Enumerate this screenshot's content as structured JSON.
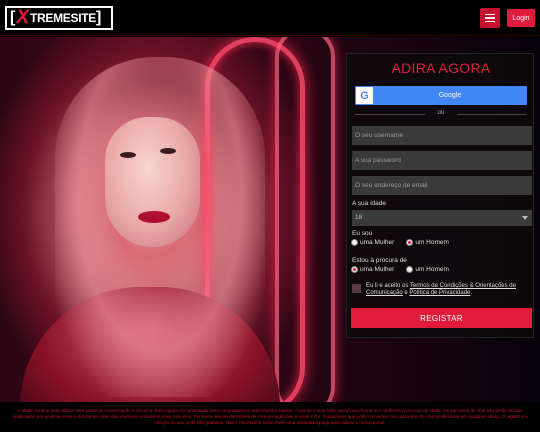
{
  "header": {
    "logo_left_bracket": "[",
    "logo_x": "X",
    "logo_text": "TREMESITE",
    "logo_right_bracket": "]",
    "menu_icon": "hamburger-icon",
    "login_label": "Login"
  },
  "colors": {
    "accent": "#e01b3c",
    "panel": "#0e0a0c",
    "field": "#3a3a3a",
    "google": "#4285f4"
  },
  "form": {
    "title": "ADIRA AGORA",
    "google_label": "Google",
    "google_icon": "G",
    "or_label": "ou",
    "username_placeholder": "O seu username",
    "password_placeholder": "A sua password",
    "email_placeholder": "O seu endereço de email",
    "age_label": "A sua idade",
    "age_value": "18",
    "i_am_label": "Eu sou",
    "i_am_options": [
      "uma Mulher",
      "um Homem"
    ],
    "i_am_selected": "um Homem",
    "looking_label": "Estou à procura de",
    "looking_options": [
      "uma Mulher",
      "um Homem"
    ],
    "looking_selected": "uma Mulher",
    "terms_prefix": "Eu li e aceito os ",
    "terms_link": "Termos de Condições & Orientações de Comunicação",
    "terms_mid": " e ",
    "privacy_link": "Política de Privacidade",
    "terms_suffix": ".",
    "register_label": "REGISTAR"
  },
  "footer": {
    "text": "A idade mínima para utilizar este portal de conversação é 18 anos. Esta página foi optimizada para computadores, telemóveis e tablets. O portal é uma rede social para homens e mulheres à procura de chats. Os parceiros de chat são perfis virtuais moderados por pessoas reais e excitantes. Não são possíveis encontros reais com eles. Por favor, leia as directrizes de comunicação nas nossas CGV. Garantimos que pode conversar com parceiros de chat profissional em qualquer altura. O registo e a criação do seu perfil são gratuitos. Não é necessário subscrever uma assinatura paga para utilizar o nosso portal."
  }
}
